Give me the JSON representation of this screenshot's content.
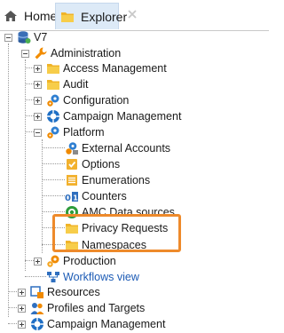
{
  "tabs": {
    "home_label": "Home",
    "explorer_label": "Explorer"
  },
  "tree": {
    "root": "V7",
    "administration": "Administration",
    "access_management": "Access Management",
    "audit": "Audit",
    "configuration": "Configuration",
    "campaign_management_admin": "Campaign Management",
    "platform": "Platform",
    "external_accounts": "External Accounts",
    "options": "Options",
    "enumerations": "Enumerations",
    "counters": "Counters",
    "amc_data_sources": "AMC Data sources",
    "privacy_requests": "Privacy Requests",
    "namespaces": "Namespaces",
    "production": "Production",
    "workflows_view": "Workflows view",
    "resources": "Resources",
    "profiles_and_targets": "Profiles and Targets",
    "campaign_management": "Campaign Management"
  },
  "colors": {
    "highlight": "#ee8a2b",
    "link": "#1c5bb5",
    "folder": "#f5c842",
    "active_tab": "#ddeaf7"
  }
}
